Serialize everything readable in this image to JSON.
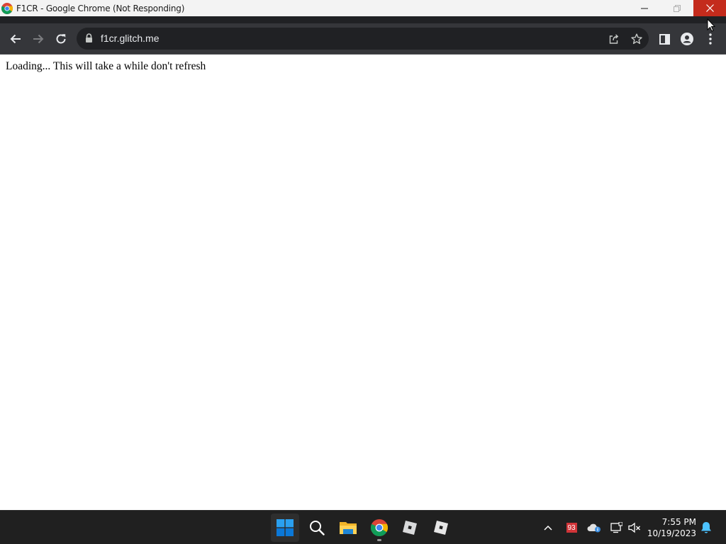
{
  "window": {
    "title": "F1CR - Google Chrome (Not Responding)",
    "controls": {
      "minimize": "minimize",
      "maximize": "maximize",
      "close": "close"
    }
  },
  "toolbar": {
    "url": "f1cr.glitch.me",
    "icons": [
      "back-icon",
      "forward-icon",
      "reload-icon",
      "lock-icon",
      "share-icon",
      "star-icon",
      "side-panel-icon",
      "profile-icon",
      "menu-icon"
    ]
  },
  "page": {
    "message": "Loading... This will take a while don't refresh"
  },
  "taskbar": {
    "apps": [
      "start",
      "search",
      "file-explorer",
      "chrome",
      "roblox",
      "roblox-studio"
    ],
    "tray": {
      "badge": "93",
      "time": "7:55 PM",
      "date": "10/19/2023"
    }
  },
  "colors": {
    "titlebar_bg": "#f3f3f3",
    "toolbar_bg": "#35363a",
    "omnibox_bg": "#202124",
    "close_button": "#c42b1c",
    "taskbar_bg": "#202020",
    "start_blue": "#0078d4"
  }
}
